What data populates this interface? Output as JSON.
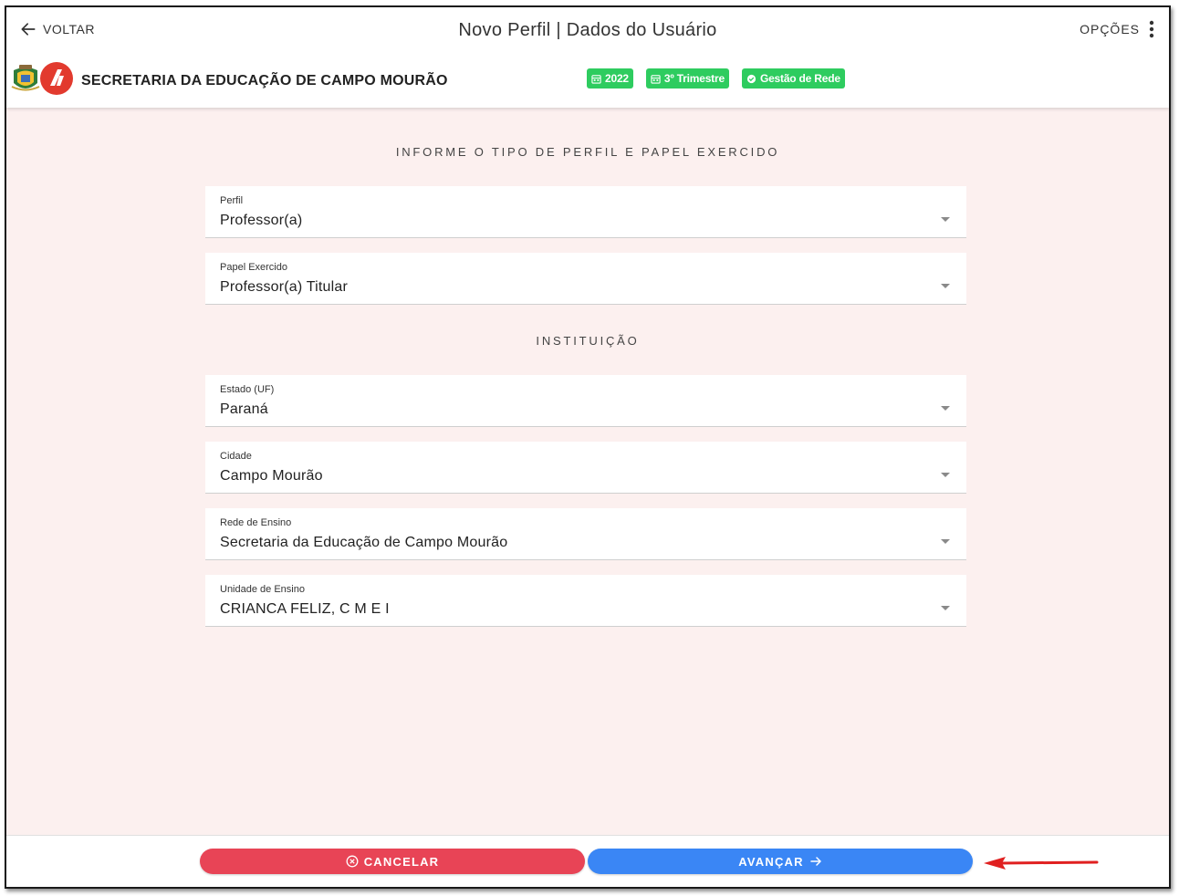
{
  "header": {
    "back_label": "VOLTAR",
    "title": "Novo Perfil | Dados do Usuário",
    "options_label": "OPÇÕES",
    "org_name": "SECRETARIA DA EDUCAÇÃO DE CAMPO MOURÃO",
    "badges": [
      {
        "label": "2022",
        "icon": "calendar-icon"
      },
      {
        "label": "3º Trimestre",
        "icon": "calendar-icon"
      },
      {
        "label": "Gestão de Rede",
        "icon": "check-circle-icon"
      }
    ]
  },
  "sections": {
    "profile_title": "INFORME O TIPO DE PERFIL E PAPEL EXERCIDO",
    "institution_title": "INSTITUIÇÃO"
  },
  "fields": [
    {
      "label": "Perfil",
      "value": "Professor(a)"
    },
    {
      "label": "Papel Exercido",
      "value": "Professor(a) Titular"
    },
    {
      "label": "Estado (UF)",
      "value": "Paraná"
    },
    {
      "label": "Cidade",
      "value": "Campo Mourão"
    },
    {
      "label": "Rede de Ensino",
      "value": "Secretaria da Educação de Campo Mourão"
    },
    {
      "label": "Unidade de Ensino",
      "value": "CRIANCA FELIZ, C M E I"
    }
  ],
  "footer": {
    "cancel_label": "CANCELAR",
    "next_label": "AVANÇAR"
  },
  "colors": {
    "badge": "#2ecc5f",
    "cancel": "#e84456",
    "next": "#3a86f5",
    "annotation_arrow": "#e02020",
    "background": "#fcf0ef"
  }
}
